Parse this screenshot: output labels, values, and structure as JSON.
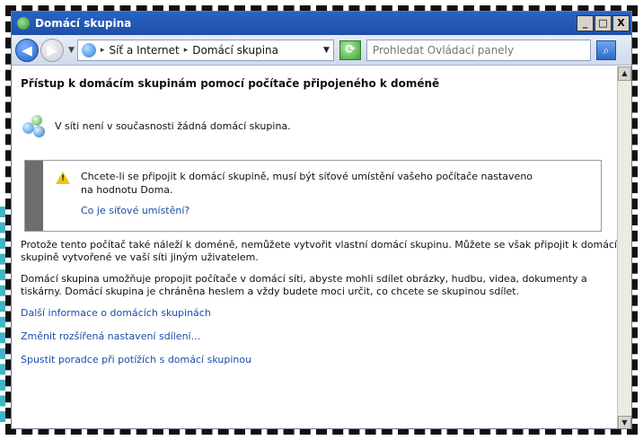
{
  "window": {
    "title": "Domácí skupina",
    "controls": {
      "minimize": "_",
      "maximize": "□",
      "close": "X"
    }
  },
  "addressbar": {
    "breadcrumb": [
      "Síť a Internet",
      "Domácí skupina"
    ],
    "search_placeholder": "Prohledat Ovládací panely"
  },
  "content": {
    "heading": "Přístup k domácím skupinám pomocí počítače připojeného k doméně",
    "status": "V síti není v současnosti žádná domácí skupina.",
    "warning": {
      "text": "Chcete-li se připojit k domácí skupině, musí být síťové umístění vašeho počítače nastaveno na hodnotu Doma.",
      "link": "Co je síťové umístění?"
    },
    "paragraph1": "Protože tento počítač také náleží k doméně, nemůžete vytvořit vlastní domácí skupinu. Můžete se však připojit k domácí skupině vytvořené ve vaší síti jiným uživatelem.",
    "paragraph2": "Domácí skupina umožňuje propojit počítače v domácí síti, abyste mohli sdílet obrázky, hudbu, videa, dokumenty a tiskárny. Domácí skupina je chráněna heslem a vždy budete moci určit, co chcete se skupinou sdílet.",
    "links": [
      "Další informace o domácích skupinách",
      "Změnit rozšířená nastavení sdílení...",
      "Spustit poradce při potížích s domácí skupinou"
    ]
  }
}
